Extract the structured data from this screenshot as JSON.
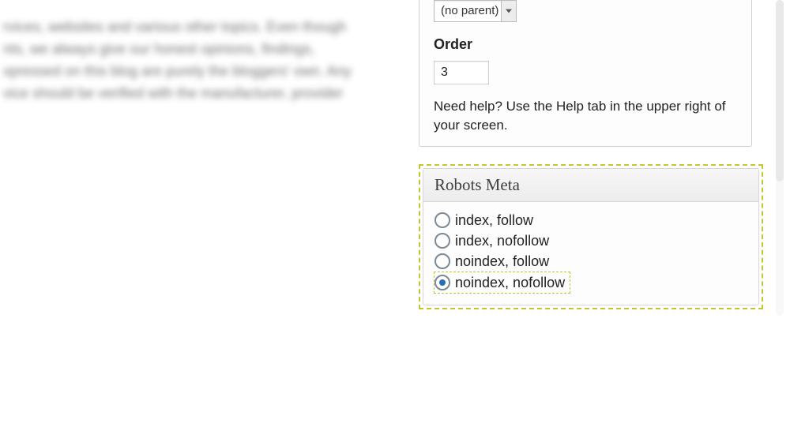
{
  "left_blur": {
    "line1": "rvices, websites and various other topics. Even though",
    "line2": "nts, we always give our honest opinions, findings,",
    "line3": "xpressed on this blog are purely the bloggers' own. Any",
    "line4": "vice should be verified with the manufacturer, provider"
  },
  "attributes": {
    "parent_value": "(no parent)",
    "order_label": "Order",
    "order_value": "3",
    "help_text": "Need help? Use the Help tab in the upper right of your screen."
  },
  "robots": {
    "title": "Robots Meta",
    "options": [
      {
        "label": "index, follow",
        "selected": false
      },
      {
        "label": "index, nofollow",
        "selected": false
      },
      {
        "label": "noindex, follow",
        "selected": false
      },
      {
        "label": "noindex, nofollow",
        "selected": true
      }
    ]
  }
}
